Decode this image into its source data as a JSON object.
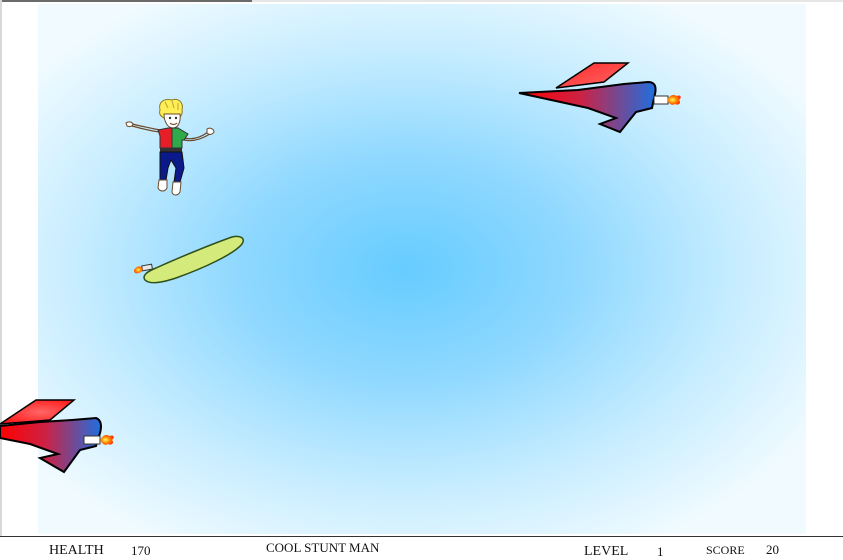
{
  "game": {
    "title": "COOL STUNT MAN"
  },
  "hud": {
    "health_label": "HEALTH",
    "health_value": "170",
    "title": "COOL STUNT MAN",
    "level_label": "LEVEL",
    "level_value": "1",
    "score_label": "SCORE",
    "score_value": "20"
  },
  "sprites": {
    "player": "stunt-man",
    "surfboard": "rocket-surfboard",
    "enemies": [
      "rocket-jet",
      "rocket-jet"
    ]
  },
  "colors": {
    "sky_center": "#66ccff",
    "sky_edge": "#f1fbff",
    "jet_red": "#ff0000",
    "jet_blue": "#1e6fe0",
    "surfboard": "#d4ea7a",
    "flame": "#ff6a00"
  }
}
